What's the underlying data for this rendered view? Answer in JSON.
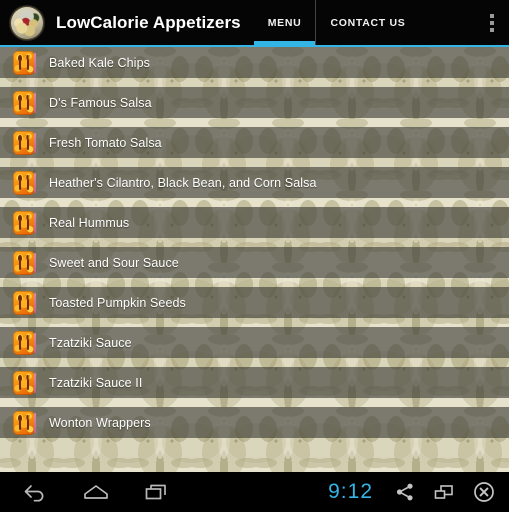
{
  "header": {
    "app_icon": "food-plate-icon",
    "title": "LowCalorie Appetizers",
    "tabs": [
      {
        "label": "MENU",
        "active": true
      },
      {
        "label": "CONTACT US",
        "active": false
      }
    ],
    "overflow_icon": "overflow-menu-icon",
    "accent_color": "#33b5e5",
    "background_color": "#050505"
  },
  "list": {
    "item_icon": "spoon-and-fork-icon",
    "items": [
      {
        "label": "Baked Kale Chips"
      },
      {
        "label": "D's Famous Salsa"
      },
      {
        "label": "Fresh Tomato Salsa"
      },
      {
        "label": "Heather's Cilantro, Black Bean, and Corn Salsa"
      },
      {
        "label": "Real Hummus"
      },
      {
        "label": "Sweet and Sour Sauce"
      },
      {
        "label": "Toasted Pumpkin Seeds"
      },
      {
        "label": "Tzatziki Sauce"
      },
      {
        "label": "Tzatziki Sauce II"
      },
      {
        "label": "Wonton Wrappers"
      }
    ],
    "row_overlay_color": "#3a3a34",
    "wallpaper_base_color": "#e6e2cc",
    "wallpaper_pattern_color": "#9b9364"
  },
  "navbar": {
    "back_icon": "back-arrow-icon",
    "home_icon": "home-icon",
    "recents_icon": "recent-apps-icon",
    "clock": "9:12",
    "share_icon": "share-icon",
    "screenshot_icon": "screenshot-icon",
    "close_icon": "close-circle-icon",
    "clock_color": "#33b5e5"
  }
}
